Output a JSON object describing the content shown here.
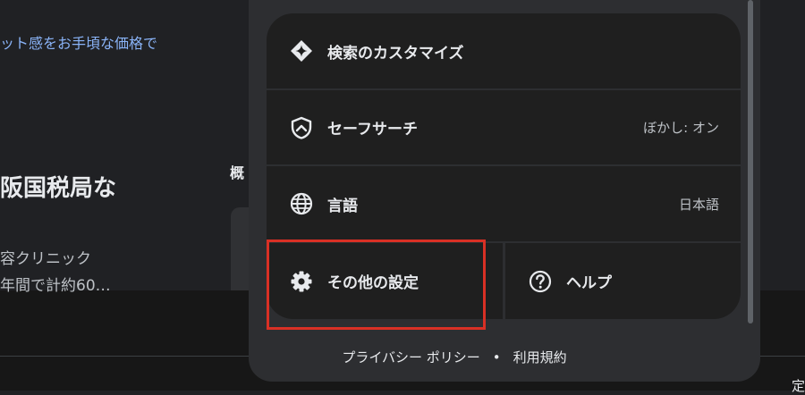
{
  "background": {
    "link_text": "ット感をお手頃な価格で",
    "heading": "阪国税局な",
    "side_label": "概",
    "snippet_line1": "容クリニック",
    "snippet_line2": "年間で計約60…",
    "bottom_right": "定"
  },
  "menu": {
    "customize_label": "検索のカスタマイズ",
    "safesearch_label": "セーフサーチ",
    "safesearch_value": "ぼかし: オン",
    "language_label": "言語",
    "language_value": "日本語",
    "other_settings_label": "その他の設定",
    "help_label": "ヘルプ"
  },
  "footer": {
    "privacy": "プライバシー ポリシー",
    "separator": "•",
    "terms": "利用規約"
  },
  "colors": {
    "highlight": "#d93025",
    "link": "#8ab4f8"
  },
  "icons": [
    "sparkle-icon",
    "shield-icon",
    "globe-icon",
    "gear-icon",
    "help-icon"
  ]
}
